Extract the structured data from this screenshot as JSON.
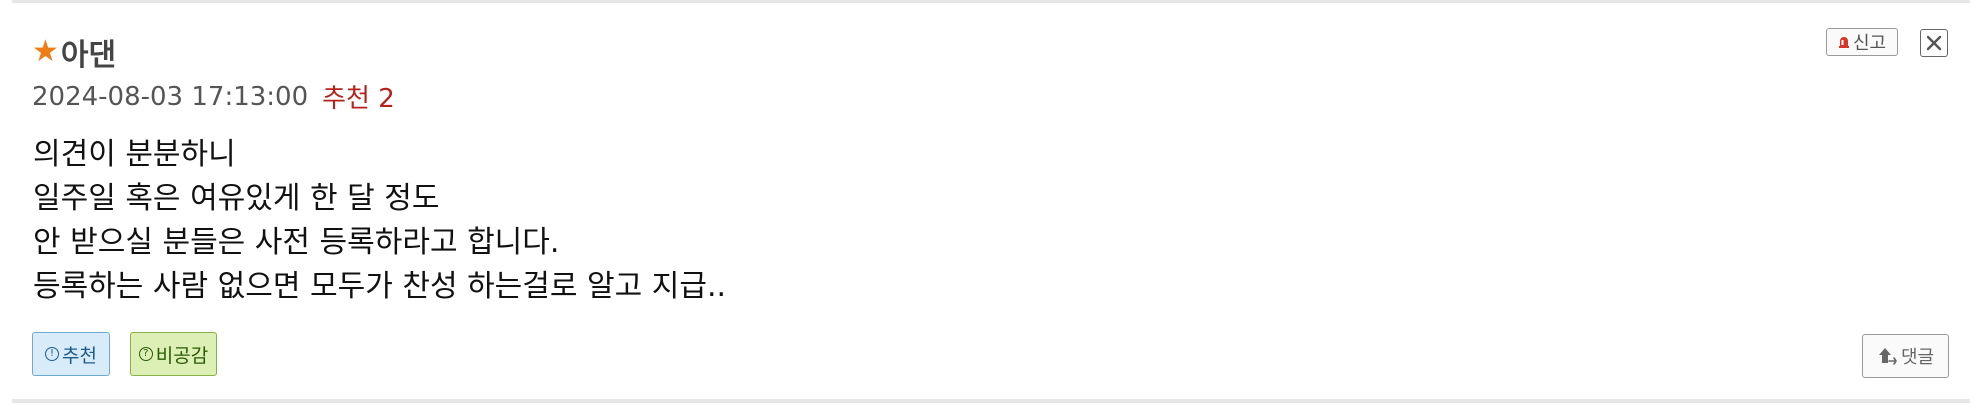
{
  "comment": {
    "author": "아댄",
    "star_icon": "star-icon",
    "star_color": "#ef7d17",
    "timestamp": "2024-08-03 17:13:00",
    "recommend_label": "추천 2",
    "recommend_color": "#b5221c",
    "body_lines": [
      "의견이 분분하니",
      "일주일 혹은 여유있게 한 달 정도",
      "안 받으실 분들은 사전 등록하라고 합니다.",
      "등록하는 사람 없으면 모두가 찬성 하는걸로 알고 지급.."
    ]
  },
  "actions": {
    "report_label": "신고",
    "report_icon": "siren-icon",
    "close_icon": "close-icon",
    "upvote_label": "추천",
    "upvote_icon": "circle-exclamation-icon",
    "upvote_color": "#d7ecf8",
    "downvote_label": "비공감",
    "downvote_icon": "circle-question-icon",
    "downvote_color": "#dcefb4",
    "reply_label": "댓글",
    "reply_icon": "reply-arrow-icon"
  }
}
